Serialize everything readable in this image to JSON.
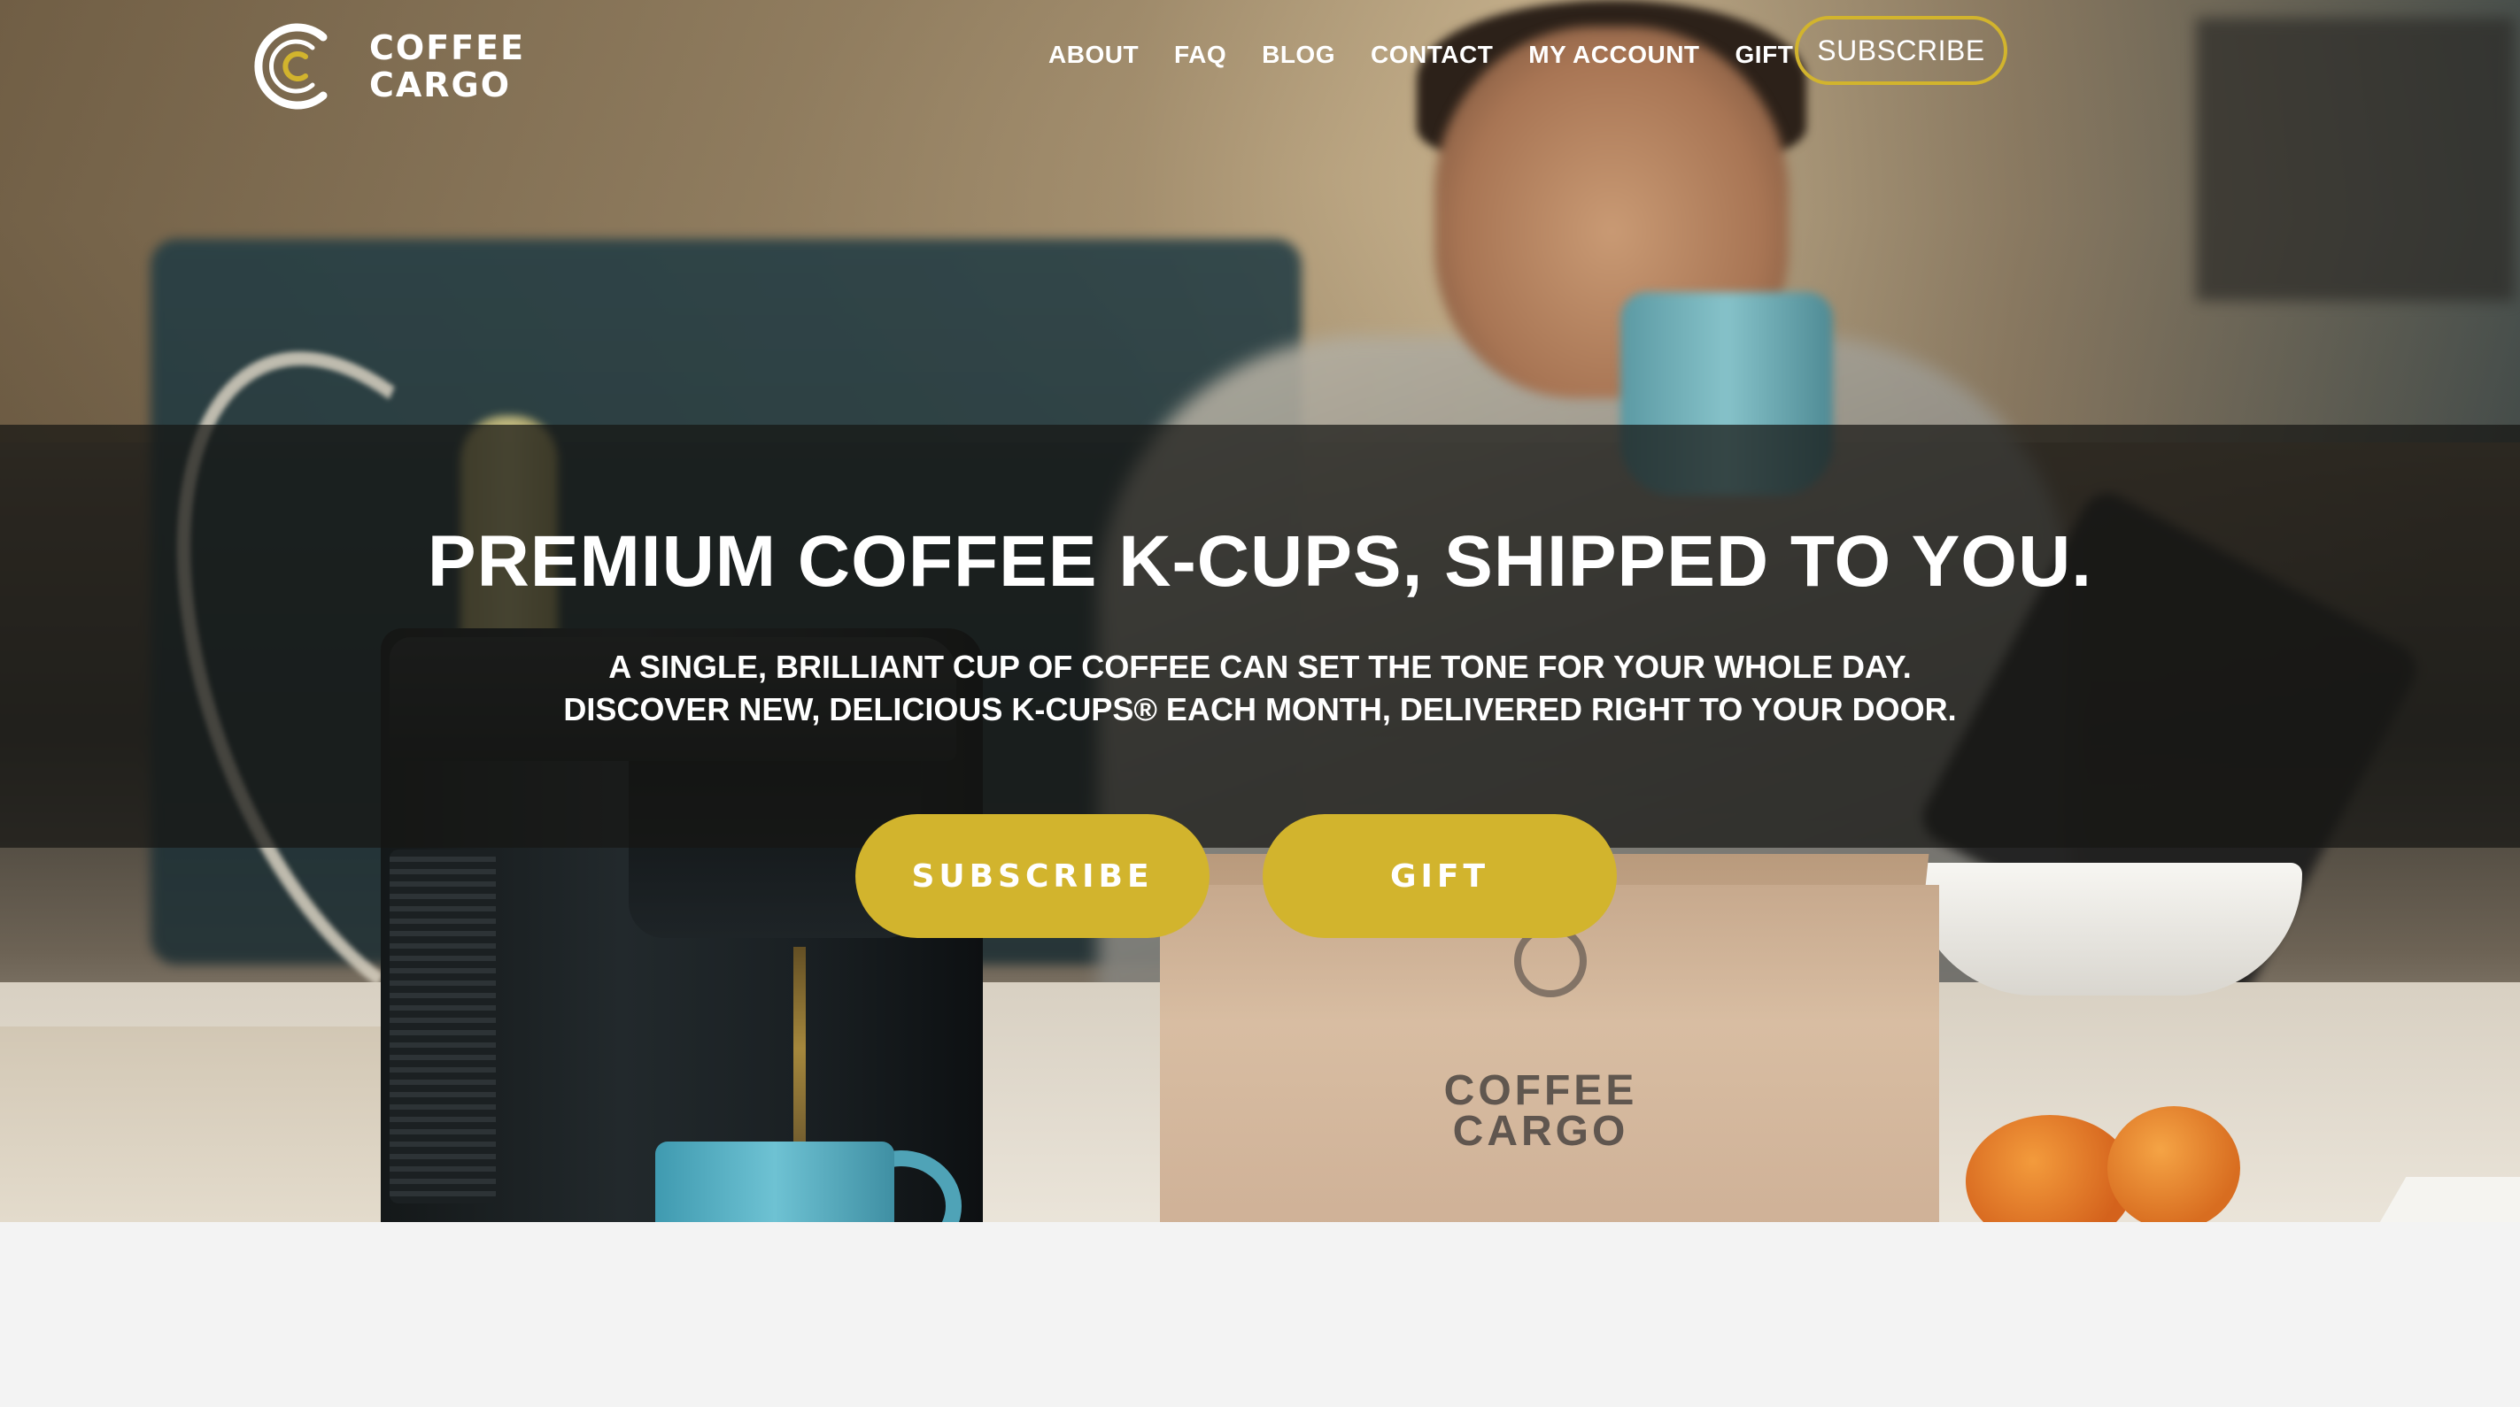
{
  "brand": {
    "name_line1": "COFFEE",
    "name_line2": "CARGO",
    "accent_color": "#d2b42d"
  },
  "nav": {
    "items": [
      {
        "label": "ABOUT"
      },
      {
        "label": "FAQ"
      },
      {
        "label": "BLOG"
      },
      {
        "label": "CONTACT"
      },
      {
        "label": "MY ACCOUNT"
      },
      {
        "label": "GIFT"
      }
    ],
    "subscribe_label": "SUBSCRIBE"
  },
  "hero": {
    "headline": "PREMIUM COFFEE K-CUPS, SHIPPED TO YOU.",
    "sub_line1": "A SINGLE, BRILLIANT CUP OF COFFEE CAN SET THE TONE FOR YOUR WHOLE DAY.",
    "sub_line2": "DISCOVER NEW, DELICIOUS K-CUPS® EACH MONTH, DELIVERED RIGHT TO YOUR DOOR.",
    "cta_subscribe": "SUBSCRIBE",
    "cta_gift": "GIFT",
    "box_print_line1": "COFFEE",
    "box_print_line2": "CARGO"
  }
}
